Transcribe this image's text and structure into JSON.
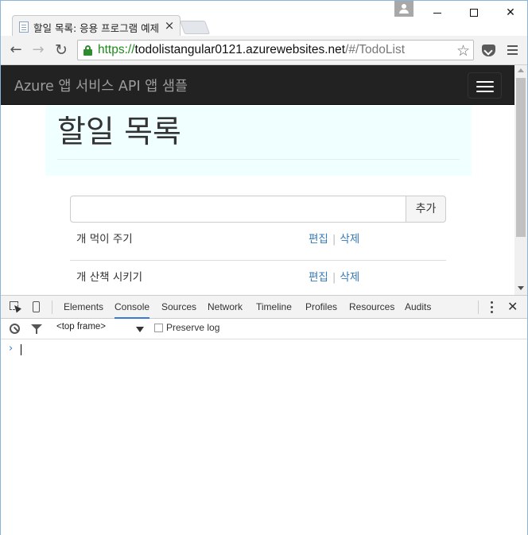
{
  "browser": {
    "tab_title": "할일 목록: 응용 프로그램 예제",
    "tab_close": "×",
    "url_scheme": "https://",
    "url_host": "todolistangular0121.azurewebsites.net",
    "url_path": "/#/TodoList",
    "back_glyph": "←",
    "forward_glyph": "→",
    "reload_glyph": "↻",
    "star_glyph": "☆",
    "close_glyph": "✕"
  },
  "page": {
    "brand": "Azure 앱 서비스 API 앱 샘플",
    "heading": "할일 목록",
    "input_value": "",
    "add_label": "추가",
    "edit_label": "편집",
    "delete_label": "삭제",
    "separator": "|",
    "todos": [
      {
        "text": "개 먹이 주기"
      },
      {
        "text": "개 산책 시키기"
      }
    ]
  },
  "devtools": {
    "tabs": [
      "Elements",
      "Console",
      "Sources",
      "Network",
      "Timeline",
      "Profiles",
      "Resources",
      "Audits"
    ],
    "active_tab": "Console",
    "frame_select": "<top frame>",
    "preserve_log_label": "Preserve log",
    "preserve_log_checked": false,
    "prompt": "›",
    "close_glyph": "✕"
  },
  "colors": {
    "navbar_bg": "#222222",
    "jumbotron_bg": "#f0ffff",
    "link": "#337ab7",
    "secure_green": "#1a8a1a",
    "devtools_active": "#3879d9"
  }
}
